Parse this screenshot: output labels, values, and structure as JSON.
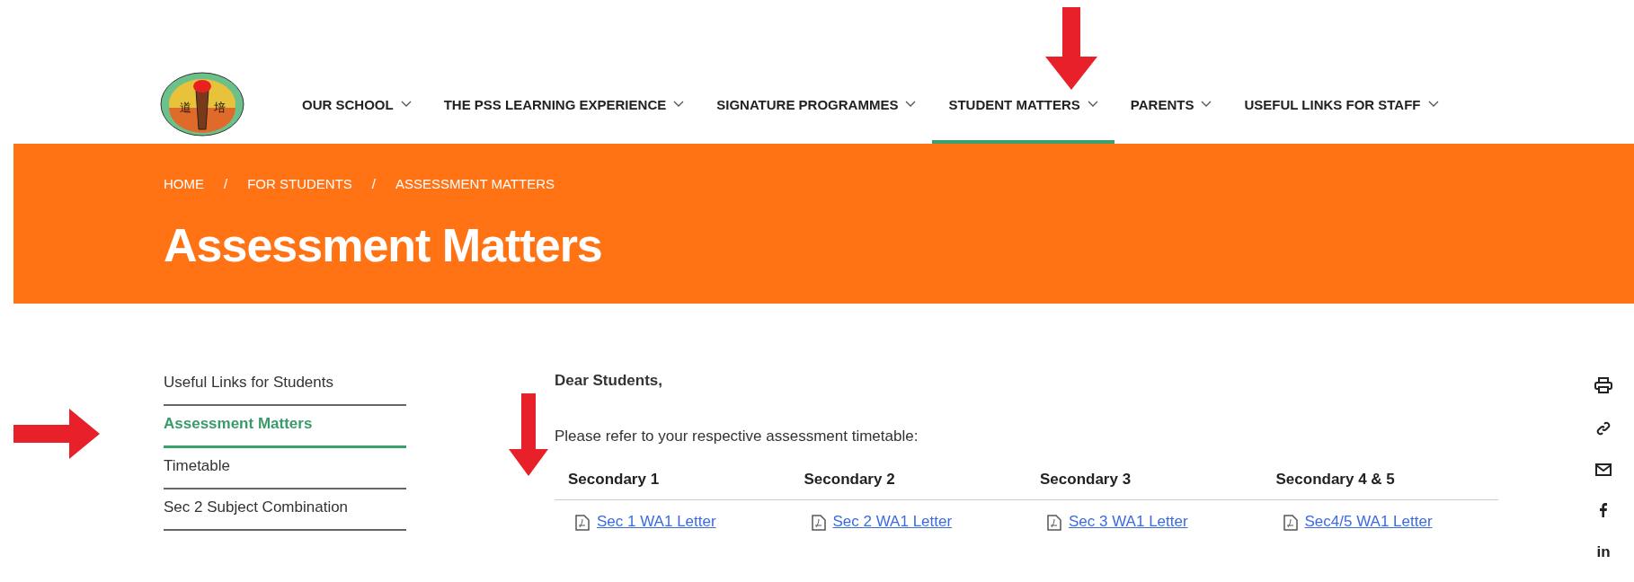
{
  "nav": {
    "items": [
      {
        "label": "OUR SCHOOL",
        "selected": false
      },
      {
        "label": "THE PSS LEARNING EXPERIENCE",
        "selected": false
      },
      {
        "label": "SIGNATURE PROGRAMMES",
        "selected": false
      },
      {
        "label": "STUDENT MATTERS",
        "selected": true
      },
      {
        "label": "PARENTS",
        "selected": false
      },
      {
        "label": "USEFUL LINKS FOR STAFF",
        "selected": false
      }
    ]
  },
  "logo": {
    "characters": [
      "道",
      "培"
    ]
  },
  "banner": {
    "breadcrumb": [
      "HOME",
      "FOR STUDENTS",
      "ASSESSMENT MATTERS"
    ],
    "separator": "/",
    "title": "Assessment Matters"
  },
  "sidebar": {
    "items": [
      {
        "label": "Useful Links for Students",
        "selected": false
      },
      {
        "label": "Assessment Matters",
        "selected": true
      },
      {
        "label": "Timetable",
        "selected": false
      },
      {
        "label": "Sec 2 Subject Combination",
        "selected": false
      }
    ]
  },
  "content": {
    "greeting": "Dear Students,",
    "intro": "Please refer to your respective assessment timetable:",
    "table": {
      "columns": [
        "Secondary 1",
        "Secondary 2",
        "Secondary 3",
        "Secondary 4 & 5"
      ],
      "links": [
        "Sec 1 WA1 Letter",
        "Sec 2 WA1 Letter",
        "Sec 3 WA1 Letter",
        "Sec4/5 WA1 Letter"
      ]
    }
  },
  "share": {
    "items": [
      {
        "kind": "print"
      },
      {
        "kind": "link"
      },
      {
        "kind": "mail"
      },
      {
        "kind": "facebook"
      },
      {
        "kind": "linkedin",
        "label": "in"
      }
    ]
  }
}
